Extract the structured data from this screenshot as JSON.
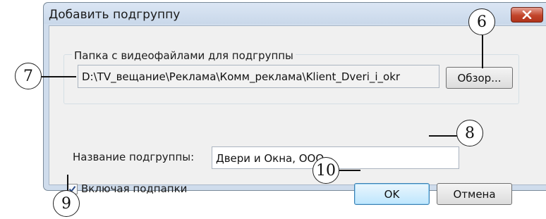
{
  "dialog": {
    "title": "Добавить подгруппу",
    "close_icon": "close-icon"
  },
  "folder_group": {
    "legend": "Папка с видеофайлами для подгруппы",
    "path_value": "D:\\TV_вещание\\Реклама\\Комм_реклама\\Klient_Dveri_i_okr",
    "browse_label": "Обзор..."
  },
  "subgroup_name": {
    "label": "Название подгруппы:",
    "value": "Двери и Окна, ООО"
  },
  "include_subfolders": {
    "label": "Включая подпапки",
    "checked": true
  },
  "buttons": {
    "ok_label": "OK",
    "cancel_label": "Отмена"
  },
  "callouts": [
    "6",
    "7",
    "8",
    "9",
    "10"
  ]
}
